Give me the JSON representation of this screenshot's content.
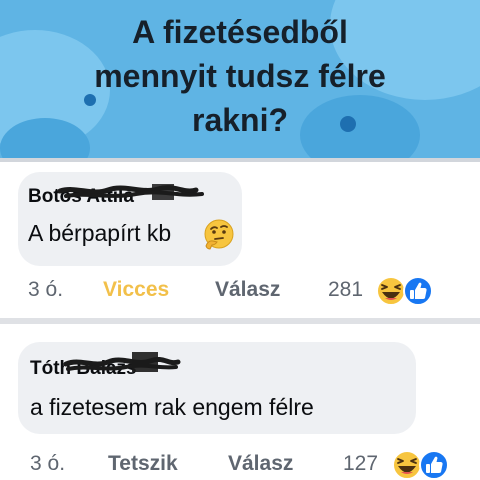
{
  "banner": {
    "title_lines": [
      "A fizetésedből",
      "mennyit tudsz félre",
      "rakni?"
    ],
    "background_color": "#5fb4e4"
  },
  "comments": [
    {
      "author": "Botos Attila",
      "text": "A bérpapírt kb",
      "emoji": "thinking-face",
      "time": "3 ó.",
      "reaction_action": "Vicces",
      "reaction_action_color": "#f2c04a",
      "reply": "Válasz",
      "reaction_count": "281",
      "reaction_icons": [
        "laughing-face-icon",
        "like-icon"
      ]
    },
    {
      "author": "Tóth Balázs",
      "text": "a fizetesem rak engem félre",
      "time": "3 ó.",
      "reaction_action": "Tetszik",
      "reply": "Válasz",
      "reaction_count": "127",
      "reaction_icons": [
        "laughing-face-icon",
        "like-icon"
      ]
    }
  ],
  "colors": {
    "bubble": "#eef0f3",
    "like_blue": "#1877f2",
    "haha_yellow": "#f7c53f"
  }
}
